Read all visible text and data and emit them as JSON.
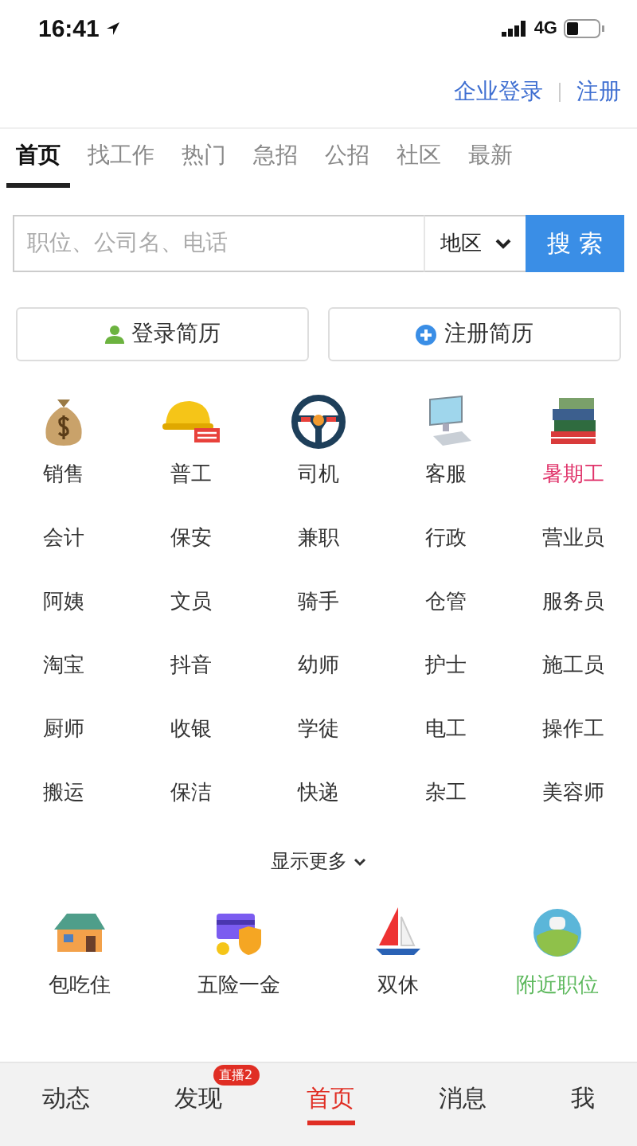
{
  "status_bar": {
    "time": "16:41",
    "network": "4G"
  },
  "header_links": [
    "企业登录",
    "注册"
  ],
  "tabs": [
    {
      "label": "首页",
      "selected": true
    },
    {
      "label": "找工作",
      "selected": false
    },
    {
      "label": "热门",
      "selected": false
    },
    {
      "label": "急招",
      "selected": false
    },
    {
      "label": "公招",
      "selected": false
    },
    {
      "label": "社区",
      "selected": false
    },
    {
      "label": "最新",
      "selected": false
    }
  ],
  "search": {
    "placeholder": "职位、公司名、电话",
    "region": "地区",
    "button": "搜 索"
  },
  "resume_buttons": [
    {
      "label": "登录简历",
      "kind": "login"
    },
    {
      "label": "注册简历",
      "kind": "register"
    }
  ],
  "featured_categories": [
    {
      "label": "销售",
      "color": "#333333"
    },
    {
      "label": "普工",
      "color": "#333333"
    },
    {
      "label": "司机",
      "color": "#333333"
    },
    {
      "label": "客服",
      "color": "#333333"
    },
    {
      "label": "暑期工",
      "color": "#e0336a"
    }
  ],
  "categories": [
    "会计",
    "保安",
    "兼职",
    "行政",
    "营业员",
    "阿姨",
    "文员",
    "骑手",
    "仓管",
    "服务员",
    "淘宝",
    "抖音",
    "幼师",
    "护士",
    "施工员",
    "厨师",
    "收银",
    "学徒",
    "电工",
    "操作工",
    "搬运",
    "保洁",
    "快递",
    "杂工",
    "美容师"
  ],
  "show_more": "显示更多",
  "benefits": [
    {
      "label": "包吃住",
      "color": "#333333"
    },
    {
      "label": "五险一金",
      "color": "#333333"
    },
    {
      "label": "双休",
      "color": "#333333"
    },
    {
      "label": "附近职位",
      "color": "#5cb85c"
    }
  ],
  "bottom_tabs": [
    {
      "label": "动态",
      "selected": false
    },
    {
      "label": "发现",
      "selected": false,
      "badge": "直播2"
    },
    {
      "label": "首页",
      "selected": true
    },
    {
      "label": "消息",
      "selected": false
    },
    {
      "label": "我",
      "selected": false
    }
  ]
}
